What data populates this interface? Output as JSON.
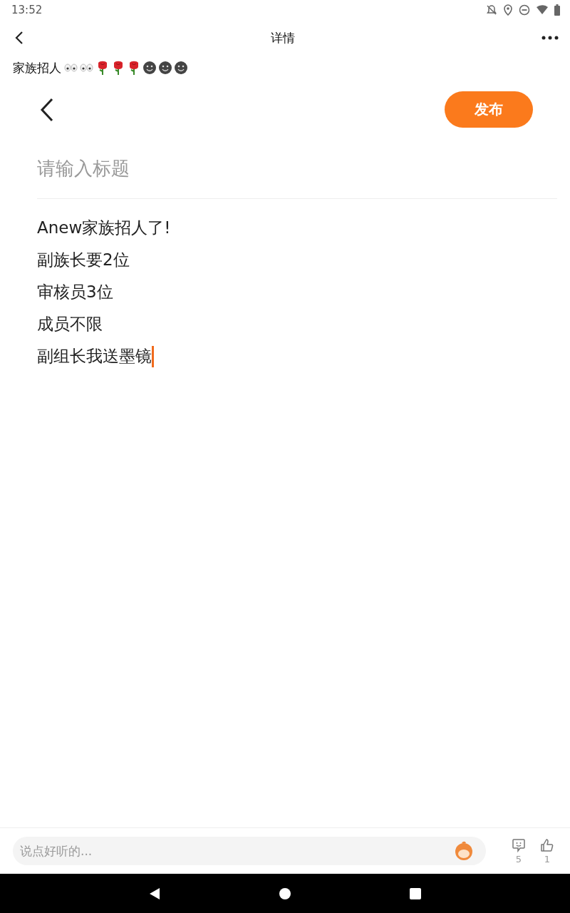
{
  "status_bar": {
    "time": "13:52"
  },
  "app_bar": {
    "title": "详情"
  },
  "post": {
    "title": "家族招人"
  },
  "embedded_screen": {
    "publish_button": "发布",
    "title_placeholder": "请输入标题",
    "body_lines": [
      "Anew家族招人了!",
      "副族长要2位",
      "审核员3位",
      "成员不限",
      "副组长我送墨镜"
    ]
  },
  "comment_bar": {
    "placeholder": "说点好听的...",
    "comment_count": "5",
    "like_count": "1"
  }
}
